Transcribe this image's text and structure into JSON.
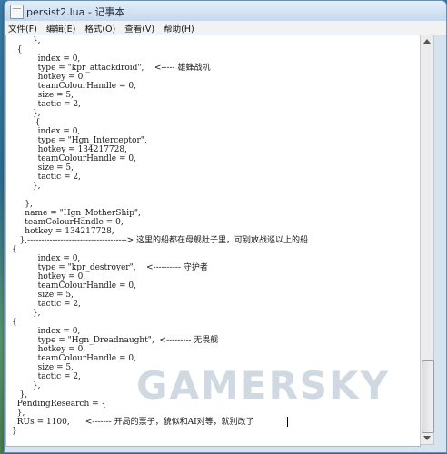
{
  "window": {
    "title": "persist2.lua - 记事本"
  },
  "menu": [
    {
      "label": "文件(F)"
    },
    {
      "label": "编辑(E)"
    },
    {
      "label": "格式(O)"
    },
    {
      "label": "查看(V)"
    },
    {
      "label": "帮助(H)"
    }
  ],
  "editor": {
    "lines": [
      "        },",
      "  {",
      "          index = 0,",
      "          type = \"kpr_attackdroid\",    <----- 雄蜂战机",
      "          hotkey = 0,",
      "          teamColourHandle = 0,",
      "          size = 5,",
      "          tactic = 2,",
      "        },",
      "         {",
      "          index = 0,",
      "          type = \"Hgn_Interceptor\",",
      "          hotkey = 134217728,",
      "          teamColourHandle = 0,",
      "          size = 5,",
      "          tactic = 2,",
      "        },",
      "",
      "     },",
      "     name = \"Hgn_MotherShip\",",
      "     teamColourHandle = 0,",
      "     hotkey = 134217728,",
      "   },------------------------------------> 这里的船都在母舰肚子里，可别放战巡以上的船",
      "{",
      "          index = 0,",
      "          type = \"kpr_destroyer\",    <---------- 守护者",
      "          hotkey = 0,",
      "          teamColourHandle = 0,",
      "          size = 5,",
      "          tactic = 2,",
      "        },",
      "{",
      "          index = 0,",
      "          type = \"Hgn_Dreadnaught\",  <--------- 无畏舰",
      "          hotkey = 0,",
      "          teamColourHandle = 0,",
      "          size = 5,",
      "          tactic = 2,",
      "        },",
      "   },",
      "  PendingResearch = {",
      "  },",
      "  RUs = 1100,      <------- 开局的票子，貌似和AI对等，就别改了",
      "}"
    ]
  },
  "watermark": "GAMERSKY"
}
